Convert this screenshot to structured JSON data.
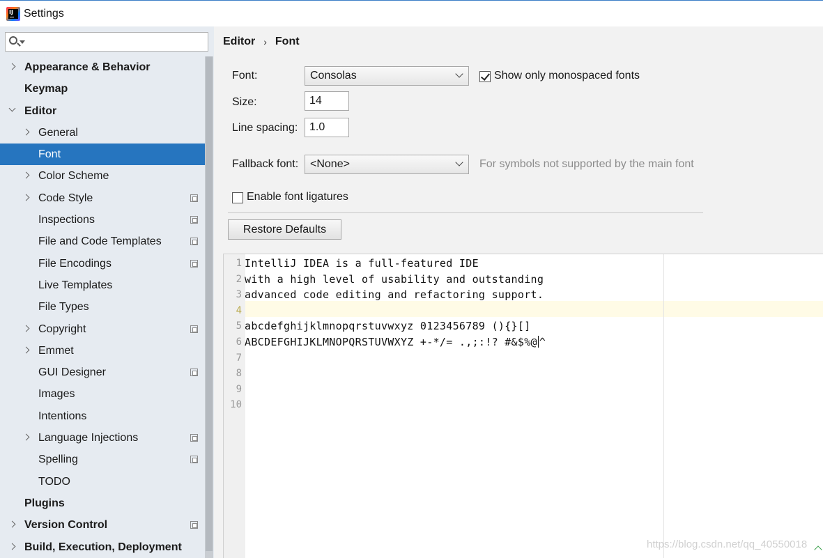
{
  "window": {
    "title": "Settings"
  },
  "search": {
    "placeholder": ""
  },
  "sidebar": {
    "items": [
      {
        "label": "Appearance & Behavior",
        "level": 0,
        "bold": true,
        "chevron": "right",
        "project_icon": false,
        "selected": false
      },
      {
        "label": "Keymap",
        "level": 0,
        "bold": true,
        "chevron": "none",
        "project_icon": false,
        "selected": false
      },
      {
        "label": "Editor",
        "level": 0,
        "bold": true,
        "chevron": "down",
        "project_icon": false,
        "selected": false
      },
      {
        "label": "General",
        "level": 1,
        "bold": false,
        "chevron": "right",
        "project_icon": false,
        "selected": false
      },
      {
        "label": "Font",
        "level": 1,
        "bold": false,
        "chevron": "none",
        "project_icon": false,
        "selected": true
      },
      {
        "label": "Color Scheme",
        "level": 1,
        "bold": false,
        "chevron": "right",
        "project_icon": false,
        "selected": false
      },
      {
        "label": "Code Style",
        "level": 1,
        "bold": false,
        "chevron": "right",
        "project_icon": true,
        "selected": false
      },
      {
        "label": "Inspections",
        "level": 1,
        "bold": false,
        "chevron": "none",
        "project_icon": true,
        "selected": false
      },
      {
        "label": "File and Code Templates",
        "level": 1,
        "bold": false,
        "chevron": "none",
        "project_icon": true,
        "selected": false
      },
      {
        "label": "File Encodings",
        "level": 1,
        "bold": false,
        "chevron": "none",
        "project_icon": true,
        "selected": false
      },
      {
        "label": "Live Templates",
        "level": 1,
        "bold": false,
        "chevron": "none",
        "project_icon": false,
        "selected": false
      },
      {
        "label": "File Types",
        "level": 1,
        "bold": false,
        "chevron": "none",
        "project_icon": false,
        "selected": false
      },
      {
        "label": "Copyright",
        "level": 1,
        "bold": false,
        "chevron": "right",
        "project_icon": true,
        "selected": false
      },
      {
        "label": "Emmet",
        "level": 1,
        "bold": false,
        "chevron": "right",
        "project_icon": false,
        "selected": false
      },
      {
        "label": "GUI Designer",
        "level": 1,
        "bold": false,
        "chevron": "none",
        "project_icon": true,
        "selected": false
      },
      {
        "label": "Images",
        "level": 1,
        "bold": false,
        "chevron": "none",
        "project_icon": false,
        "selected": false
      },
      {
        "label": "Intentions",
        "level": 1,
        "bold": false,
        "chevron": "none",
        "project_icon": false,
        "selected": false
      },
      {
        "label": "Language Injections",
        "level": 1,
        "bold": false,
        "chevron": "right",
        "project_icon": true,
        "selected": false
      },
      {
        "label": "Spelling",
        "level": 1,
        "bold": false,
        "chevron": "none",
        "project_icon": true,
        "selected": false
      },
      {
        "label": "TODO",
        "level": 1,
        "bold": false,
        "chevron": "none",
        "project_icon": false,
        "selected": false
      },
      {
        "label": "Plugins",
        "level": 0,
        "bold": true,
        "chevron": "none",
        "project_icon": false,
        "selected": false
      },
      {
        "label": "Version Control",
        "level": 0,
        "bold": true,
        "chevron": "right",
        "project_icon": true,
        "selected": false
      },
      {
        "label": "Build, Execution, Deployment",
        "level": 0,
        "bold": true,
        "chevron": "right",
        "project_icon": false,
        "selected": false
      }
    ]
  },
  "breadcrumb": {
    "parent": "Editor",
    "separator": "›",
    "current": "Font"
  },
  "form": {
    "font_label": "Font:",
    "font_value": "Consolas",
    "monospaced_label": "Show only monospaced fonts",
    "monospaced_checked": true,
    "size_label": "Size:",
    "size_value": "14",
    "line_spacing_label": "Line spacing:",
    "line_spacing_value": "1.0",
    "fallback_label": "Fallback font:",
    "fallback_value": "<None>",
    "fallback_hint": "For symbols not supported by the main font",
    "ligatures_label": "Enable font ligatures",
    "ligatures_checked": false,
    "restore_button": "Restore Defaults"
  },
  "preview": {
    "lines": [
      {
        "num": "1",
        "text": "IntelliJ IDEA is a full-featured IDE"
      },
      {
        "num": "2",
        "text": "with a high level of usability and outstanding"
      },
      {
        "num": "3",
        "text": "advanced code editing and refactoring support."
      },
      {
        "num": "4",
        "text": ""
      },
      {
        "num": "5",
        "text": "abcdefghijklmnopqrstuvwxyz 0123456789 (){}[]"
      },
      {
        "num": "6",
        "text": "ABCDEFGHIJKLMNOPQRSTUVWXYZ +-*/= .,;:!? #&$%@|^"
      },
      {
        "num": "7",
        "text": ""
      },
      {
        "num": "8",
        "text": ""
      },
      {
        "num": "9",
        "text": ""
      },
      {
        "num": "10",
        "text": ""
      }
    ]
  },
  "watermark": "https://blog.csdn.net/qq_40550018",
  "colors": {
    "selection": "#2675bf",
    "sidebar_bg": "#e6ebf1",
    "caret_row": "#fffbe6"
  }
}
